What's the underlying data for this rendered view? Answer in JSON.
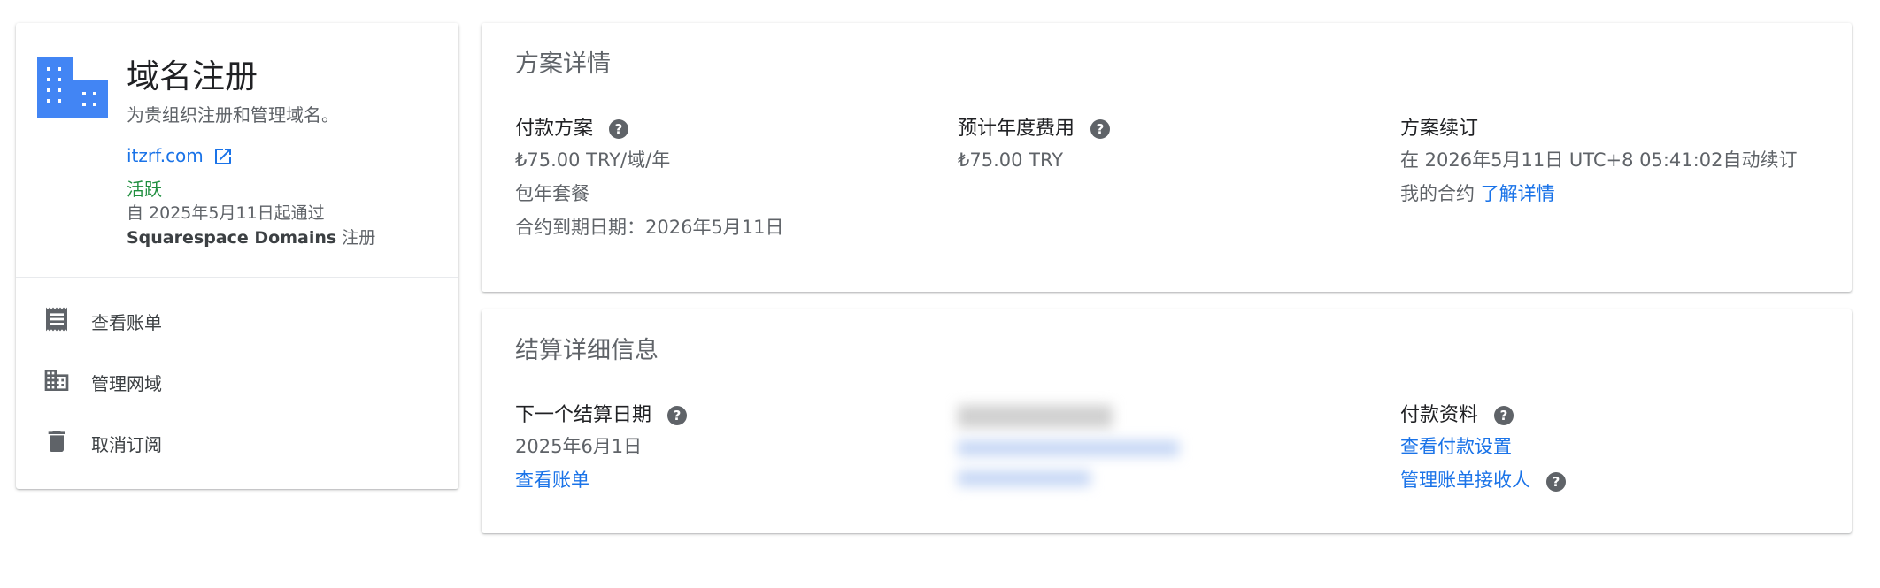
{
  "domain_card": {
    "title": "域名注册",
    "subtitle": "为贵组织注册和管理域名。",
    "domain": "itzrf.com",
    "status": "活跃",
    "since": "自 2025年5月11日起通过",
    "registrar_name": "Squarespace Domains",
    "registrar_suffix": " 注册",
    "icon_color": "#4285f4"
  },
  "menu": [
    {
      "label": "查看账单",
      "icon": "receipt-icon"
    },
    {
      "label": "管理网域",
      "icon": "domain-icon"
    },
    {
      "label": "取消订阅",
      "icon": "trash-icon"
    }
  ],
  "plan": {
    "title": "方案详情",
    "payment_plan": {
      "label": "付款方案",
      "price": "₺75.00 TRY/域/年",
      "type": "包年套餐",
      "expiry": "合约到期日期：2026年5月11日"
    },
    "annual_cost": {
      "label": "预计年度费用",
      "value": "₺75.00 TRY"
    },
    "renewal": {
      "label": "方案续订",
      "text": "在 2026年5月11日 UTC+8 05:41:02自动续订",
      "contract_prefix": "我的合约 ",
      "learn_more": "了解详情"
    }
  },
  "billing": {
    "title": "结算详细信息",
    "next_billing": {
      "label": "下一个结算日期",
      "date": "2025年6月1日",
      "view_bill": "查看账单"
    },
    "payment_profile": {
      "label": "付款资料",
      "view_settings": "查看付款设置",
      "manage_recipients": "管理账单接收人"
    }
  },
  "colors": {
    "accent": "#1a73e8",
    "active": "#1e8e3e",
    "secondary_text": "#5f6368"
  }
}
